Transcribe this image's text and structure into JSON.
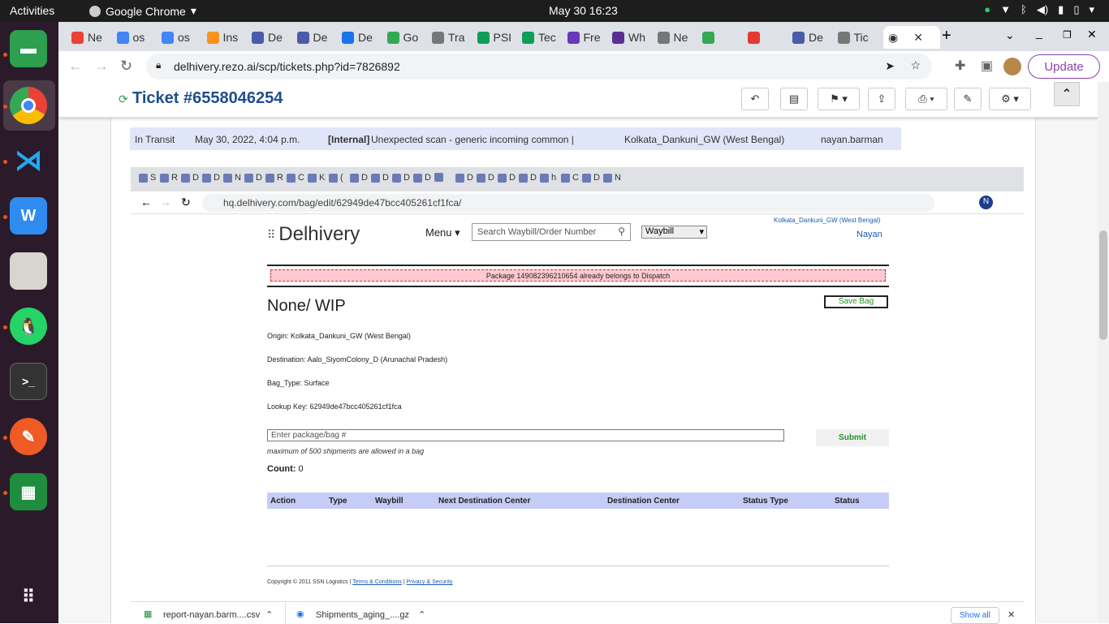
{
  "topbar": {
    "activities": "Activities",
    "app": "Google Chrome",
    "clock": "May 30  16:23"
  },
  "tabs": [
    {
      "label": "Ne",
      "color": "#ea4335"
    },
    {
      "label": "os",
      "color": "#4285f4"
    },
    {
      "label": "os",
      "color": "#4285f4"
    },
    {
      "label": "Ins",
      "color": "#f7931e"
    },
    {
      "label": "De",
      "color": "#4b5ba8"
    },
    {
      "label": "De",
      "color": "#4b5ba8"
    },
    {
      "label": "De",
      "color": "#1a73e8"
    },
    {
      "label": "Go",
      "color": "#34a853"
    },
    {
      "label": "Tra",
      "color": "#777"
    },
    {
      "label": "PSI",
      "color": "#0f9d58"
    },
    {
      "label": "Tec",
      "color": "#0f9d58"
    },
    {
      "label": "Fre",
      "color": "#673ab7"
    },
    {
      "label": "Wh",
      "color": "#5c2d91"
    },
    {
      "label": "Ne",
      "color": "#777"
    },
    {
      "label": "",
      "color": "#34a853"
    },
    {
      "label": "",
      "color": "#e53935"
    },
    {
      "label": "De",
      "color": "#4b5ba8"
    },
    {
      "label": "Tic",
      "color": "#777"
    }
  ],
  "active_tab": {
    "close": "✕"
  },
  "address": {
    "url": "delhivery.rezo.ai/scp/tickets.php?id=7826892",
    "update": "Update"
  },
  "ticket": {
    "title": "Ticket #6558046254"
  },
  "transit_row": {
    "status": "In Transit",
    "date": "May 30, 2022, 4:04 p.m.",
    "tag": "[Internal]",
    "desc": "Unexpected scan - generic incoming common |",
    "location": "Kolkata_Dankuni_GW (West Bengal)",
    "user": "nayan.barman"
  },
  "inner_browser": {
    "url": "hq.delhivery.com/bag/edit/62949de47bcc405261cf1fca/",
    "avatar": "N",
    "tabs": [
      "S",
      "R",
      "D",
      "D",
      "N",
      "D",
      "R",
      "C",
      "K",
      "(",
      "D",
      "D",
      "D",
      "D",
      "",
      "D",
      "D",
      "D",
      "D",
      "h",
      "C",
      "D",
      "N"
    ]
  },
  "delhivery": {
    "logo": "Delhivery",
    "menu": "Menu",
    "search_placeholder": "Search Waybill/Order Number",
    "search_type": "Waybill",
    "location": "Kolkata_Dankuni_GW (West Bengal)",
    "user": "Nayan",
    "alert": "Package 14908239621065​4 already belongs to Dispatch",
    "bag_title": "None/ WIP",
    "save_bag": "Save Bag",
    "origin": "Origin: Kolkata_Dankuni_GW (West Bengal)",
    "destination": "Destination: Aalo_SiyomColony_D (Arunachal Pradesh)",
    "bag_type": "Bag_Type: Surface",
    "lookup": "Lookup Key: 62949de47bcc405261cf1fca",
    "input_placeholder": "Enter package/bag #",
    "submit": "Submit",
    "max_note": "maximum of 500 shipments are allowed in a bag",
    "count_label": "Count:",
    "count_value": "0",
    "columns": [
      "Action",
      "Type",
      "Waybill",
      "Next Destination Center",
      "Destination Center",
      "Status Type",
      "Status"
    ],
    "copyright": "Copyright © 2011 SSN Logistics |",
    "terms": "Terms & Conditions",
    "privacy": "Privacy & Security"
  },
  "downloads": {
    "file1": "report-nayan.barm....csv",
    "file2": "Shipments_aging_....gz",
    "show_all": "Show all"
  }
}
